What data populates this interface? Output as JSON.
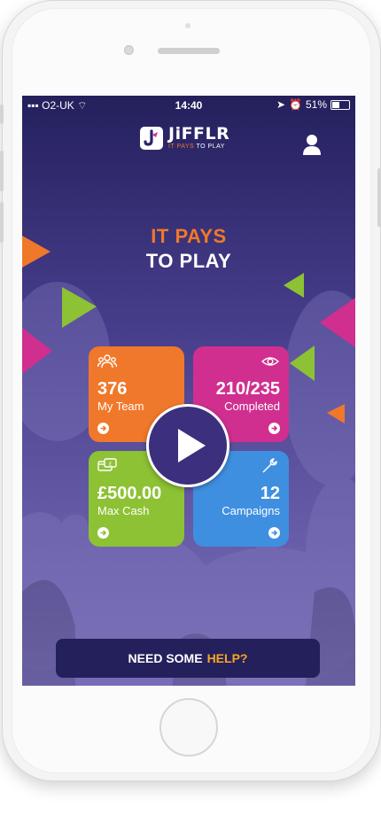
{
  "status_bar": {
    "carrier": "O2-UK",
    "time": "14:40",
    "battery": "51%",
    "battery_level": 0.51
  },
  "header": {
    "logo_word": "JiFFLR",
    "tagline_part1": "IT PAYS",
    "tagline_part2": " TO PLAY",
    "profile_icon": "user-icon"
  },
  "hero": {
    "line1": "IT PAYS",
    "line2": "TO PLAY"
  },
  "tiles": [
    {
      "icon": "team-icon",
      "value": "376",
      "label": "My Team",
      "color": "#f0782a"
    },
    {
      "icon": "eye-icon",
      "value": "210/235",
      "label": "Completed",
      "color": "#d02f8f"
    },
    {
      "icon": "cash-card-icon",
      "value": "£500.00",
      "label": "Max Cash",
      "color": "#8dc234"
    },
    {
      "icon": "wrench-icon",
      "value": "12",
      "label": "Campaigns",
      "color": "#3f8fe0"
    }
  ],
  "help": {
    "text": "NEED SOME",
    "highlight": "HELP?"
  },
  "colors": {
    "orange": "#f0782a",
    "magenta": "#d02f8f",
    "green": "#8dc234",
    "blue": "#3f8fe0",
    "navy": "#24205c",
    "help_yellow": "#f5a623"
  }
}
